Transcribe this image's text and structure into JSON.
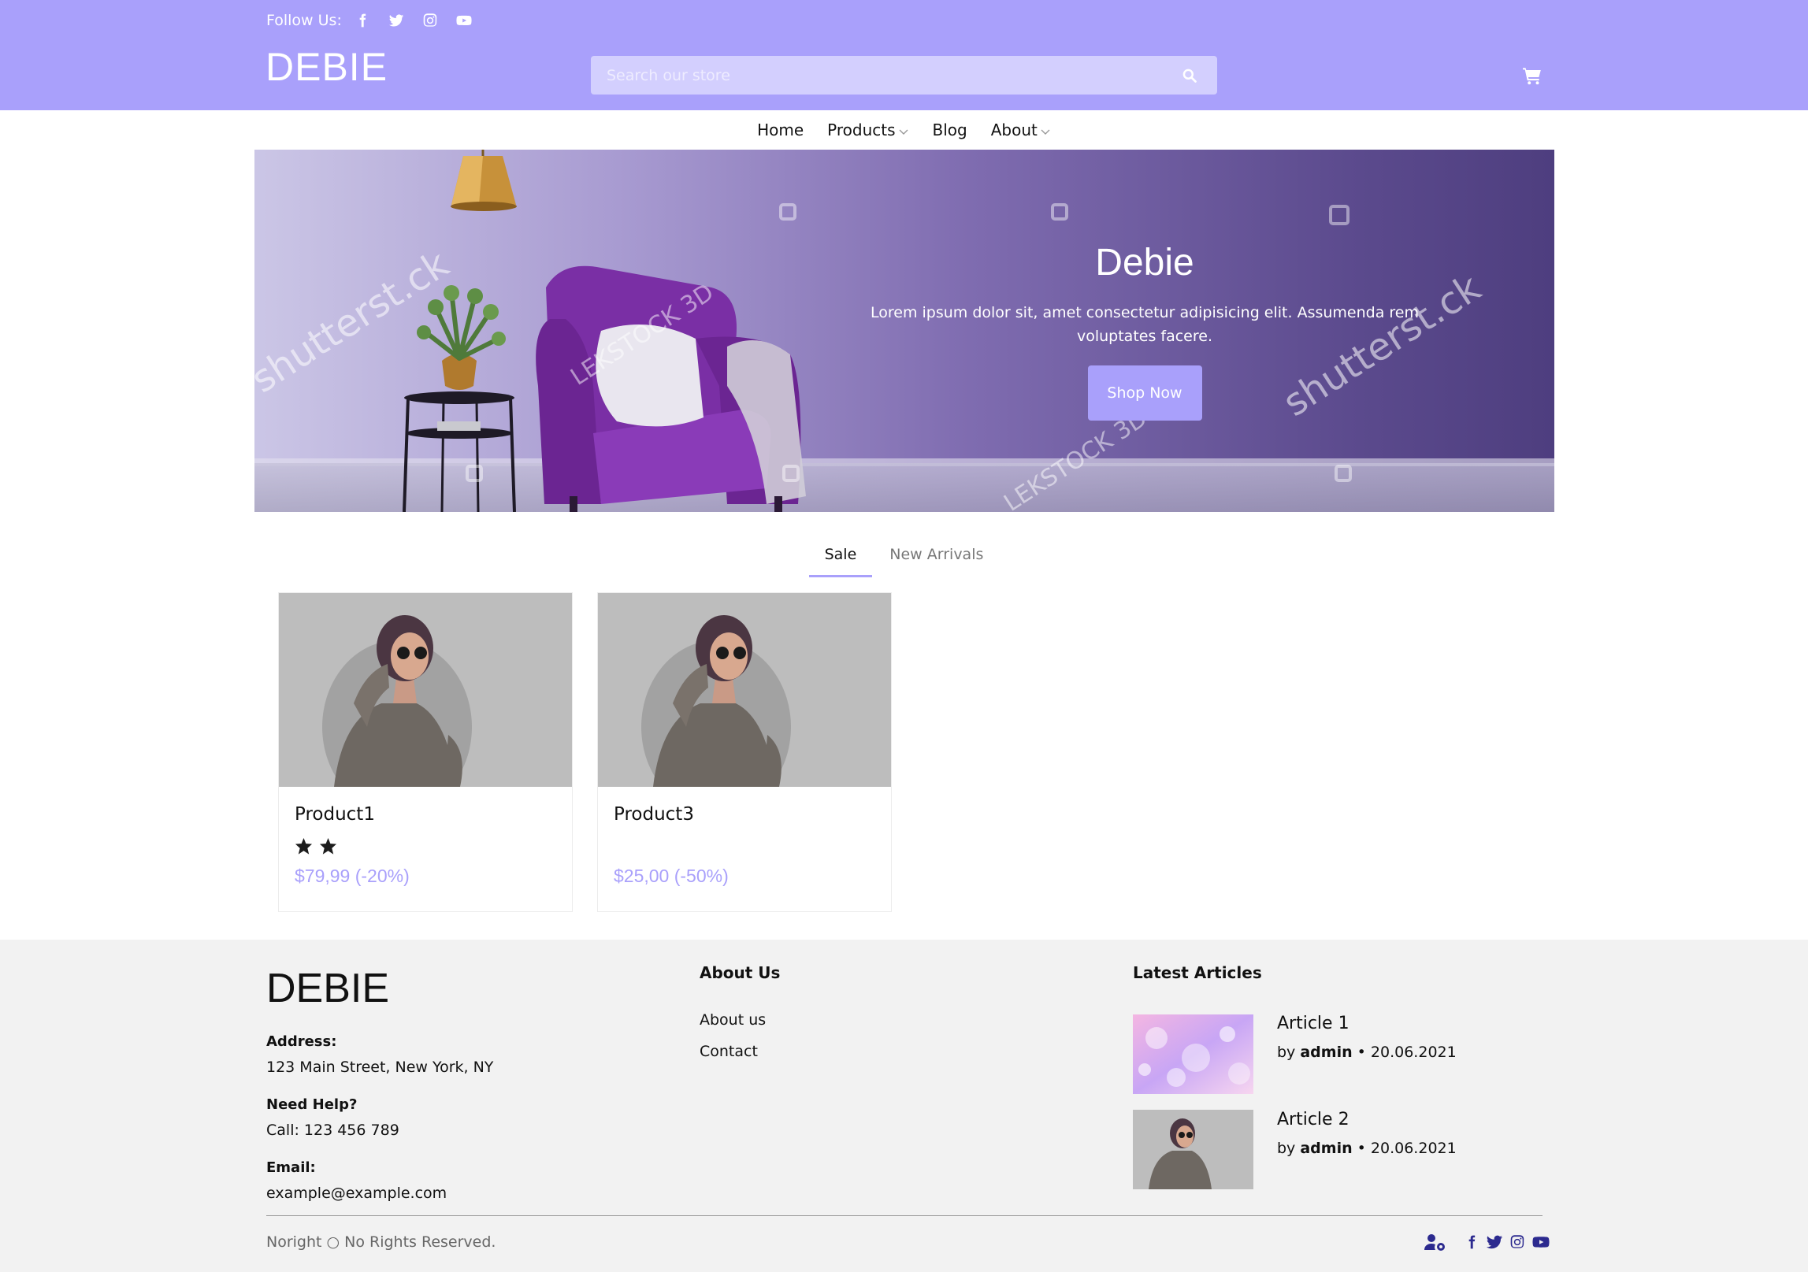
{
  "colors": {
    "accent": "#a9a0fb",
    "footer_bg": "#f2f2f2",
    "footer_icon": "#2c2a8f"
  },
  "header": {
    "follow_label": "Follow Us:",
    "social_icons": [
      "facebook-icon",
      "twitter-icon",
      "instagram-icon",
      "youtube-icon"
    ],
    "logo": "DEBIE",
    "search_placeholder": "Search our store"
  },
  "nav": {
    "items": [
      {
        "label": "Home",
        "dropdown": false
      },
      {
        "label": "Products",
        "dropdown": true
      },
      {
        "label": "Blog",
        "dropdown": false
      },
      {
        "label": "About",
        "dropdown": true
      }
    ]
  },
  "hero": {
    "title": "Debie",
    "description": "Lorem ipsum dolor sit, amet consectetur adipisicing elit. Assumenda rem voluptates facere.",
    "button": "Shop Now",
    "watermarks": [
      "shutterst.ck",
      "LEKSTOCK 3D",
      "shutterst.ck",
      "LEKSTOCK 3D"
    ]
  },
  "tabs": [
    {
      "label": "Sale",
      "active": true
    },
    {
      "label": "New Arrivals",
      "active": false
    }
  ],
  "products": [
    {
      "name": "Product1",
      "stars": 2,
      "price": "$79,99 (-20%)"
    },
    {
      "name": "Product3",
      "stars": 0,
      "price": "$25,00 (-50%)"
    }
  ],
  "footer": {
    "logo": "DEBIE",
    "address_label": "Address:",
    "address": "123 Main Street, New York, NY",
    "help_label": "Need Help?",
    "help": "Call: 123 456 789",
    "email_label": "Email:",
    "email": "example@example.com",
    "about_heading": "About Us",
    "about_links": [
      "About us",
      "Contact"
    ],
    "articles_heading": "Latest Articles",
    "articles": [
      {
        "title": "Article 1",
        "by": "by",
        "author": "admin",
        "date": "• 20.06.2021"
      },
      {
        "title": "Article 2",
        "by": "by",
        "author": "admin",
        "date": "• 20.06.2021"
      }
    ],
    "copyright": "Noright ○ No Rights Reserved.",
    "bottom_icons": [
      "user-cog-icon",
      "facebook-icon",
      "twitter-icon",
      "instagram-icon",
      "youtube-icon"
    ]
  }
}
